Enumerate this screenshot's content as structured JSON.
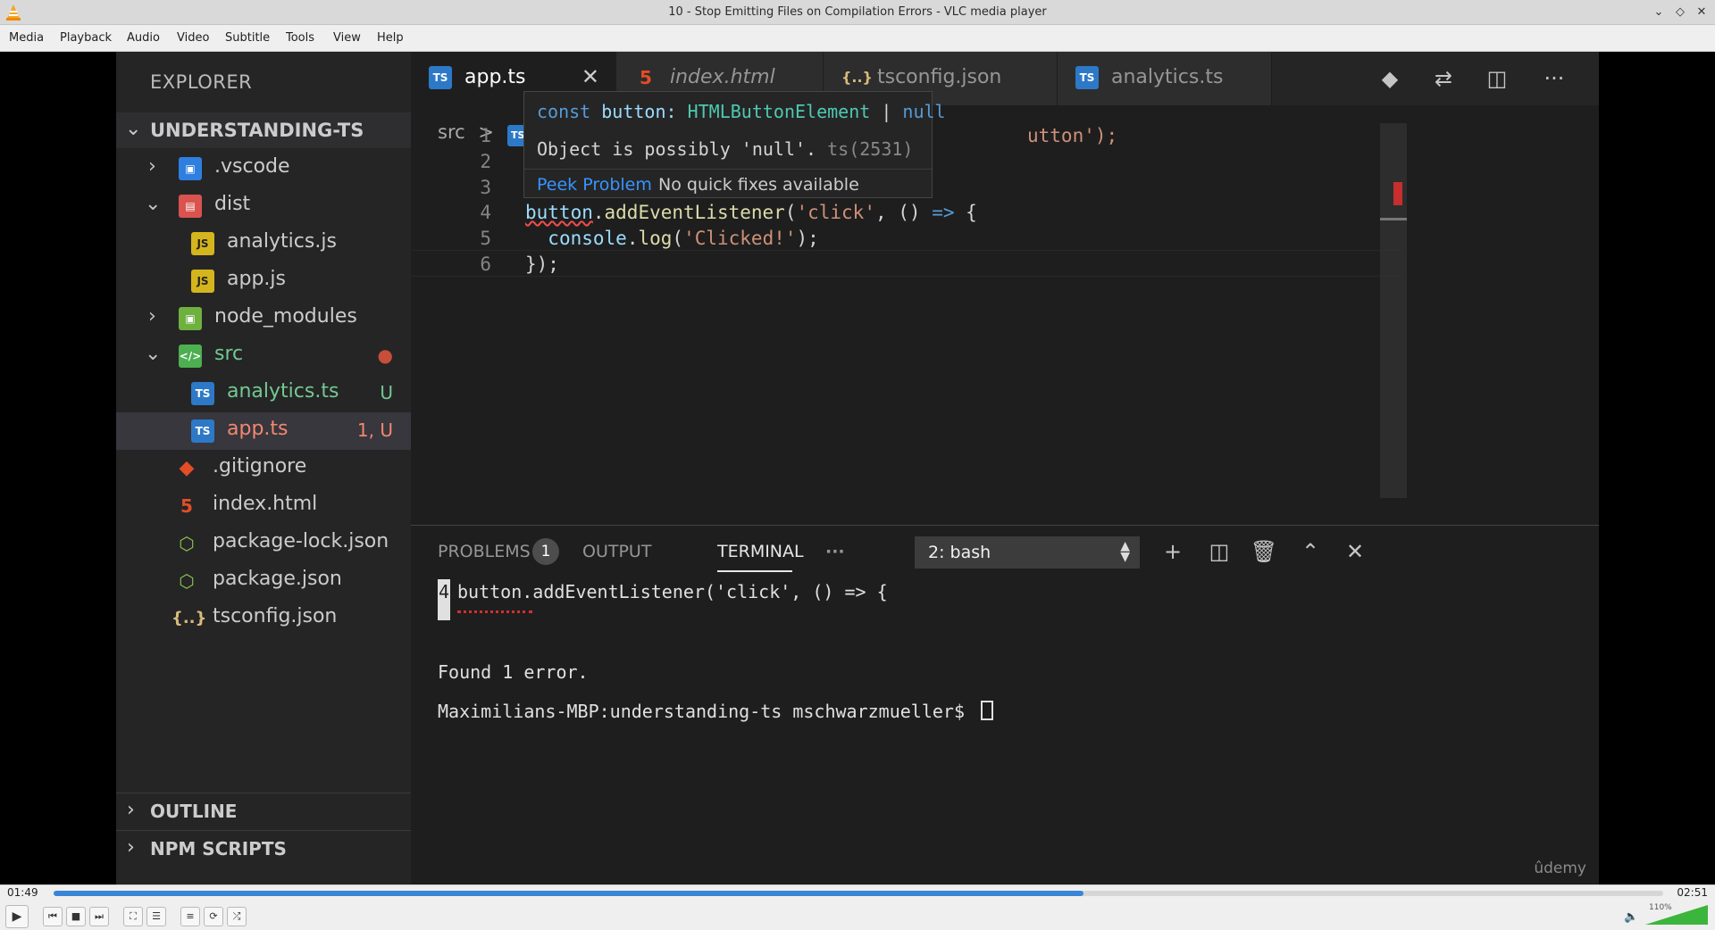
{
  "window": {
    "title": "10 - Stop Emitting Files on Compilation Errors - VLC media player"
  },
  "menu": [
    "Media",
    "Playback",
    "Audio",
    "Video",
    "Subtitle",
    "Tools",
    "View",
    "Help"
  ],
  "vscode": {
    "sidebar": {
      "title": "EXPLORER",
      "project": "UNDERSTANDING-TS",
      "tree": [
        {
          "label": ".vscode",
          "icon": "folder-vscode-icon",
          "type": "folder",
          "expanded": false
        },
        {
          "label": "dist",
          "icon": "folder-dist-icon",
          "type": "folder",
          "expanded": true
        },
        {
          "label": "analytics.js",
          "icon": "js-file-icon",
          "type": "file"
        },
        {
          "label": "app.js",
          "icon": "js-file-icon",
          "type": "file"
        },
        {
          "label": "node_modules",
          "icon": "folder-node-icon",
          "type": "folder",
          "expanded": false
        },
        {
          "label": "src",
          "icon": "folder-src-icon",
          "type": "folder",
          "expanded": true,
          "badge": "●"
        },
        {
          "label": "analytics.ts",
          "icon": "ts-file-icon",
          "type": "file",
          "badge": "U"
        },
        {
          "label": "app.ts",
          "icon": "ts-file-icon",
          "type": "file",
          "badge": "1, U",
          "selected": true
        },
        {
          "label": ".gitignore",
          "icon": "git-icon",
          "type": "file"
        },
        {
          "label": "index.html",
          "icon": "html-icon",
          "type": "file"
        },
        {
          "label": "package-lock.json",
          "icon": "npm-icon",
          "type": "file"
        },
        {
          "label": "package.json",
          "icon": "npm-icon",
          "type": "file"
        },
        {
          "label": "tsconfig.json",
          "icon": "json-icon",
          "type": "file"
        }
      ],
      "outline": "OUTLINE",
      "npm_scripts": "NPM SCRIPTS"
    },
    "tabs": [
      {
        "label": "app.ts",
        "icon_text": "TS",
        "active": true
      },
      {
        "label": "index.html",
        "icon_text": "5",
        "italic": true
      },
      {
        "label": "tsconfig.json",
        "icon_text": "{..}"
      },
      {
        "label": "analytics.ts",
        "icon_text": "TS"
      }
    ],
    "breadcrumb": {
      "folder": "src",
      "sep": ">",
      "icon_text": "TS"
    },
    "line_numbers": [
      "1",
      "2",
      "3",
      "4",
      "5",
      "6"
    ],
    "code": {
      "line1_tail": "utton');",
      "line4": {
        "var": "button",
        "rest1": ".",
        "fn": "addEventListener",
        "p1": "(",
        "str": "'click'",
        "p2": ", () ",
        "arrow": "=>",
        "p3": " {"
      },
      "line5": {
        "indent": "  ",
        "var": "console",
        "dot": ".",
        "fn": "log",
        "p1": "(",
        "str": "'Clicked!'",
        "p2": ");"
      },
      "line6": "});"
    },
    "hover": {
      "kw": "const",
      "name": " button: ",
      "type": "HTMLButtonElement",
      "pipe": " | ",
      "null": "null",
      "message": "Object is possibly 'null'. ",
      "code": "ts(2531)",
      "peek": "Peek Problem",
      "no_fixes": "No quick fixes available"
    },
    "panel": {
      "problems": "PROBLEMS",
      "problems_count": "1",
      "output": "OUTPUT",
      "terminal": "TERMINAL",
      "more": "···",
      "shell": "2: bash",
      "terminal_lines": {
        "gutter": "4",
        "code": "button.addEventListener('click', () => {",
        "found": "Found 1 error.",
        "prompt": "Maximilians-MBP:understanding-ts mschwarzmueller$ "
      },
      "watermark": "ûdemy"
    }
  },
  "player": {
    "elapsed": "01:49",
    "total": "02:51",
    "progress_pct": 64,
    "volume_label": "110%",
    "volume_pct": 100
  }
}
